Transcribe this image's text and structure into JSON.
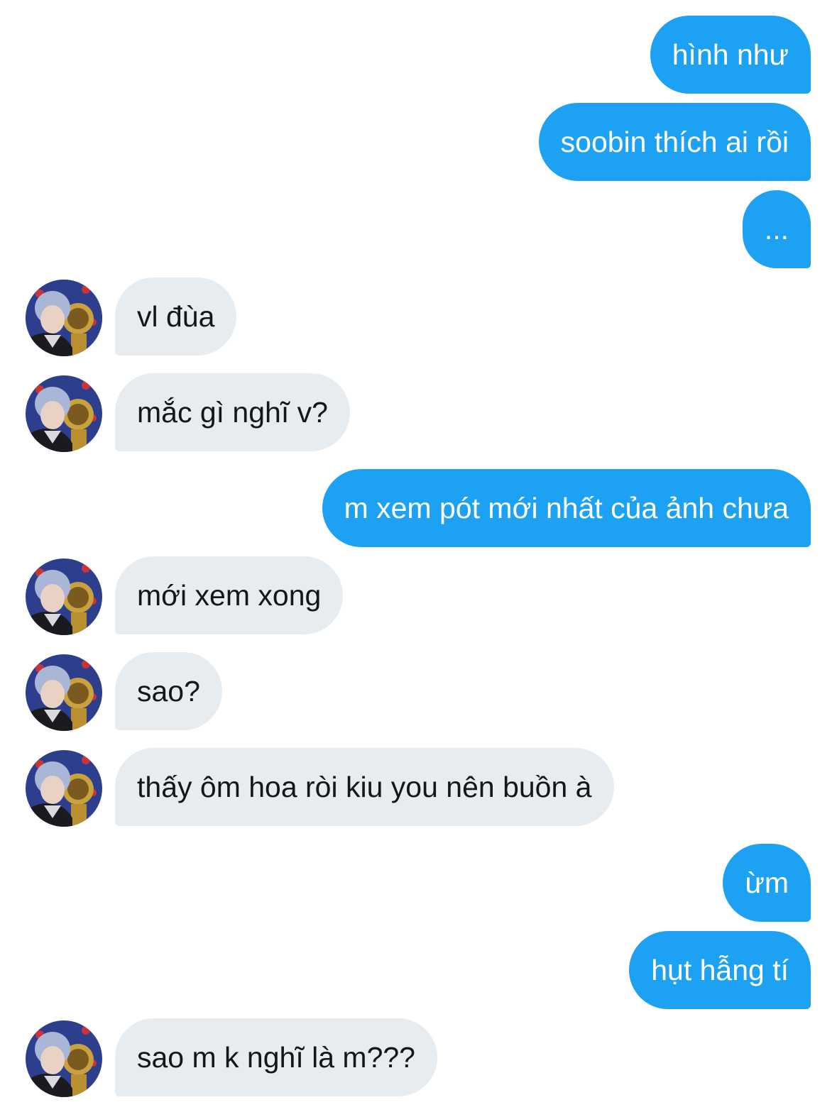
{
  "conversation": {
    "messages": [
      {
        "side": "sent",
        "text": "hình như"
      },
      {
        "side": "sent",
        "text": "soobin thích ai rồi"
      },
      {
        "side": "sent",
        "text": "..."
      },
      {
        "side": "received",
        "text": "vl đùa",
        "avatar": "contact-avatar"
      },
      {
        "side": "received",
        "text": "mắc gì nghĩ v?",
        "avatar": "contact-avatar"
      },
      {
        "side": "sent",
        "text": "m xem pót mới nhất của ảnh chưa"
      },
      {
        "side": "received",
        "text": "mới xem xong",
        "avatar": "contact-avatar"
      },
      {
        "side": "received",
        "text": "sao?",
        "avatar": "contact-avatar"
      },
      {
        "side": "received",
        "text": "thấy ôm hoa ròi kiu you nên buồn à",
        "avatar": "contact-avatar"
      },
      {
        "side": "sent",
        "text": "ừm"
      },
      {
        "side": "sent",
        "text": "hụt hẫng tí"
      },
      {
        "side": "received",
        "text": "sao m k nghĩ là m???",
        "avatar": "contact-avatar"
      }
    ]
  },
  "colors": {
    "sent_bubble": "#1da1f2",
    "sent_text": "#ffffff",
    "received_bubble": "#e6ecf0",
    "received_text": "#14171a"
  }
}
